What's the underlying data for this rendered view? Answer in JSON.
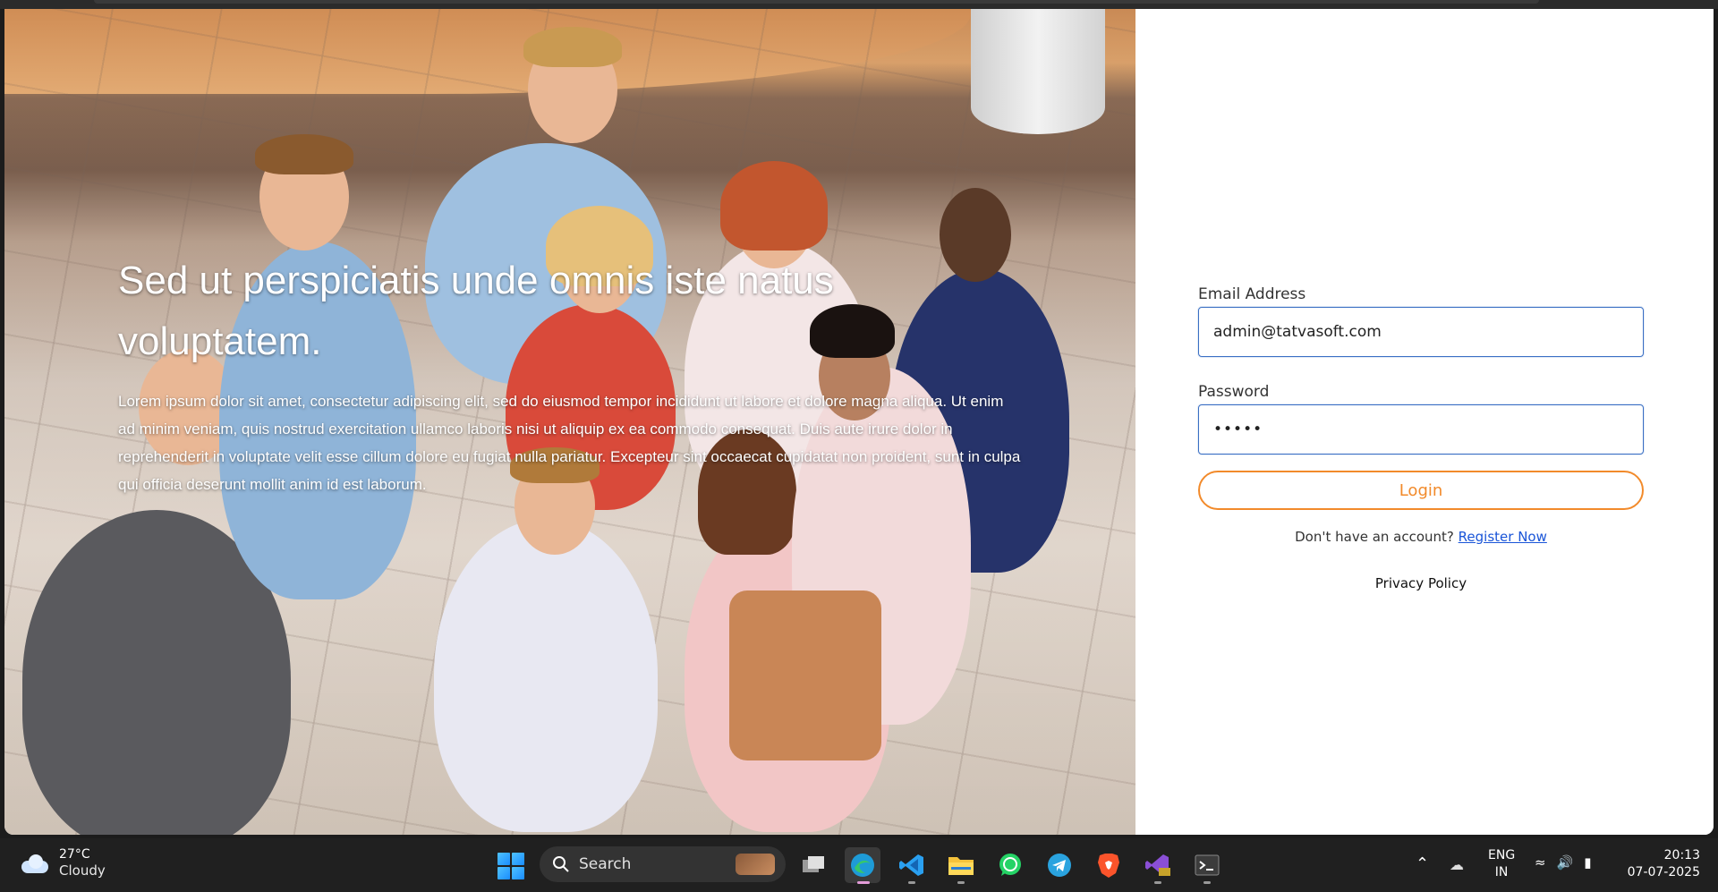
{
  "hero": {
    "title": "Sed ut perspiciatis unde omnis iste natus voluptatem.",
    "text": "Lorem ipsum dolor sit amet, consectetur adipiscing elit, sed do eiusmod tempor incididunt ut labore et dolore magna aliqua. Ut enim ad minim veniam, quis nostrud exercitation ullamco laboris nisi ut aliquip ex ea commodo consequat. Duis aute irure dolor in reprehenderit in voluptate velit esse cillum dolore eu fugiat nulla pariatur. Excepteur sint occaecat cupidatat non proident, sunt in culpa qui officia deserunt mollit anim id est laborum."
  },
  "login": {
    "email_label": "Email Address",
    "email_value": "admin@tatvasoft.com",
    "password_label": "Password",
    "password_value": "•••••",
    "login_button": "Login",
    "register_prompt": "Don't have an account?",
    "register_link": "Register Now",
    "privacy_link": "Privacy Policy",
    "accent_color": "#f28a2a",
    "link_color": "#1a55d8"
  },
  "taskbar": {
    "weather": {
      "temp": "27°C",
      "condition": "Cloudy",
      "icon": "cloud-icon"
    },
    "search_label": "Search",
    "apps": [
      "windows-start-icon",
      "task-view-icon",
      "edge-icon",
      "vscode-icon",
      "file-explorer-icon",
      "whatsapp-icon",
      "telegram-icon",
      "brave-icon",
      "visual-studio-icon",
      "terminal-icon"
    ],
    "language": {
      "line1": "ENG",
      "line2": "IN"
    },
    "clock": {
      "time": "20:13",
      "date": "07-07-2025"
    }
  }
}
